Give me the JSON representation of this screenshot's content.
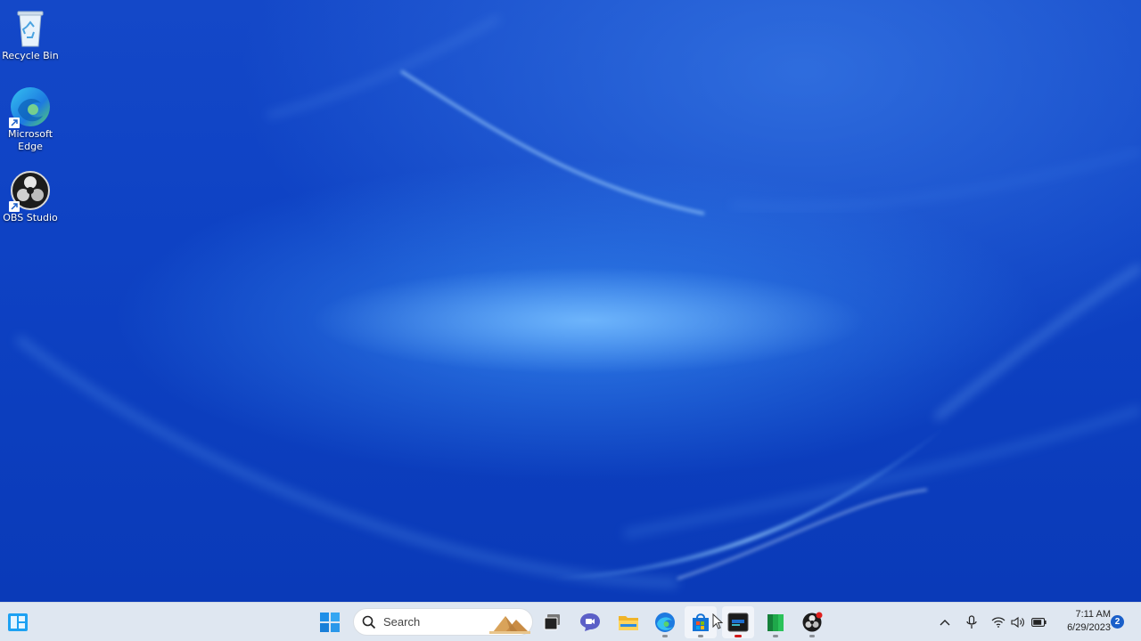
{
  "desktop": {
    "icons": [
      {
        "label": "Recycle Bin",
        "icon": "recycle-bin-icon"
      },
      {
        "label": "Microsoft\nEdge",
        "icon": "edge-icon"
      },
      {
        "label": "OBS Studio",
        "icon": "obs-icon"
      }
    ]
  },
  "taskbar": {
    "search": {
      "placeholder": "Search"
    },
    "apps": [
      {
        "name": "task-view",
        "icon": "task-view-icon"
      },
      {
        "name": "chat",
        "icon": "teams-chat-icon"
      },
      {
        "name": "file-explorer",
        "icon": "folder-icon"
      },
      {
        "name": "edge",
        "icon": "edge-icon"
      },
      {
        "name": "microsoft-store",
        "icon": "store-icon"
      },
      {
        "name": "terminal",
        "icon": "terminal-icon"
      },
      {
        "name": "green-app",
        "icon": "green-app-icon"
      },
      {
        "name": "obs",
        "icon": "obs-icon"
      }
    ],
    "clock": {
      "time": "7:11 AM",
      "date": "6/29/2023"
    },
    "notifications": {
      "count": "2"
    }
  },
  "colors": {
    "wallpaper": "#0e42c4",
    "taskbar": "#dfe7f1",
    "accent": "#1a5fc9"
  }
}
